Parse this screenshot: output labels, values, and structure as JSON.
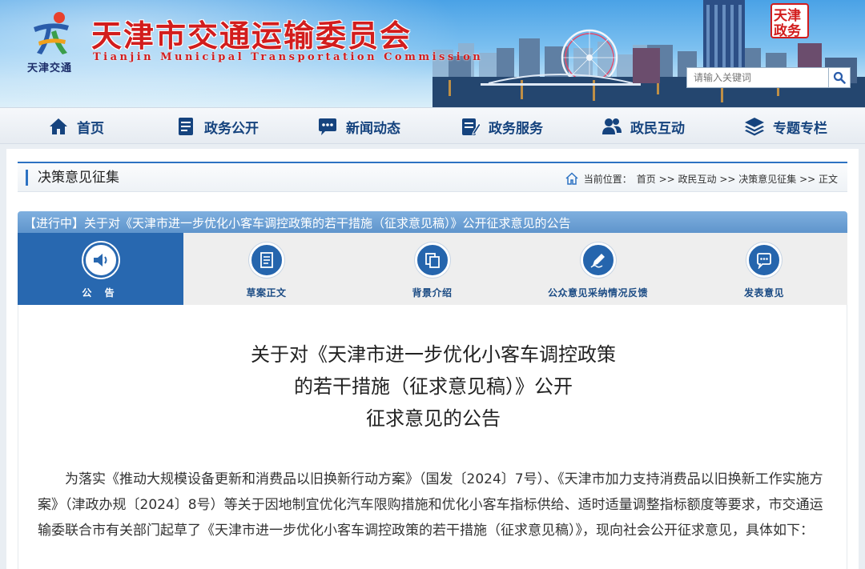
{
  "header": {
    "site_title": "天津市交通运输委员会",
    "site_subtitle": "Tianjin Municipal Transportation Commission",
    "logo_caption": "天津交通",
    "seal_text": "天津政务",
    "search_placeholder": "请输入关键词",
    "brand_red": "#d21d1d",
    "brand_blue": "#15437e"
  },
  "nav": {
    "items": [
      {
        "label": "首页",
        "icon": "home-icon"
      },
      {
        "label": "政务公开",
        "icon": "document-icon"
      },
      {
        "label": "新闻动态",
        "icon": "chat-icon"
      },
      {
        "label": "政务服务",
        "icon": "clipboard-icon"
      },
      {
        "label": "政民互动",
        "icon": "users-icon"
      },
      {
        "label": "专题专栏",
        "icon": "layers-icon"
      }
    ]
  },
  "section": {
    "title": "决策意见征集",
    "location_label": "当前位置：",
    "breadcrumb": "首页 >> 政民互动 >> 决策意见征集 >> 正文"
  },
  "notice": {
    "status": "【进行中】",
    "text": "关于对《天津市进一步优化小客车调控政策的若干措施（征求意见稿）》公开征求意见的公告"
  },
  "tabs": [
    {
      "label": "公  告",
      "icon": "speaker-icon"
    },
    {
      "label": "草案正文",
      "icon": "draft-icon"
    },
    {
      "label": "背景介绍",
      "icon": "copy-icon"
    },
    {
      "label": "公众意见采纳情况反馈",
      "icon": "pen-icon"
    },
    {
      "label": "发表意见",
      "icon": "comment-icon"
    }
  ],
  "document": {
    "title_lines": [
      "关于对《天津市进一步优化小客车调控政策",
      "的若干措施（征求意见稿）》公开",
      "征求意见的公告"
    ],
    "paragraph": "为落实《推动大规模设备更新和消费品以旧换新行动方案》（国发〔2024〕7号）、《天津市加力支持消费品以旧换新工作实施方案》（津政办规〔2024〕8号）等关于因地制宜优化汽车限购措施和优化小客车指标供给、适时适量调整指标额度等要求，市交通运输委联合市有关部门起草了《天津市进一步优化小客车调控政策的若干措施（征求意见稿）》，现向社会公开征求意见，具体如下："
  }
}
